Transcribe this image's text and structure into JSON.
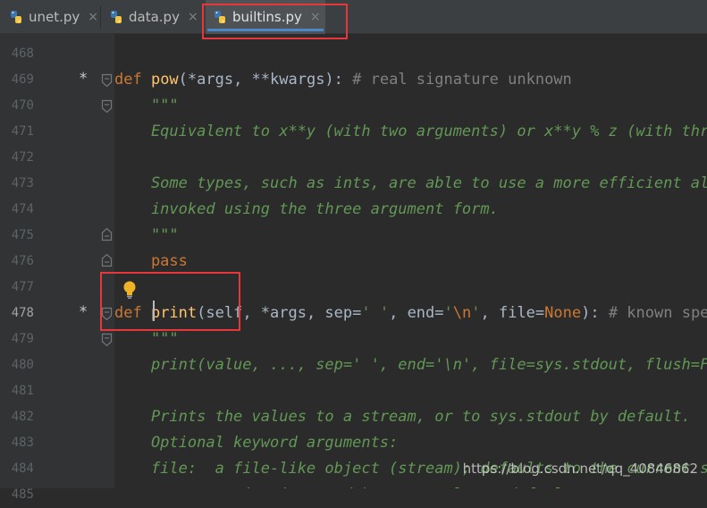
{
  "tabs": [
    {
      "label": "unet.py",
      "close": "×",
      "active": false
    },
    {
      "label": "data.py",
      "close": "×",
      "active": false
    },
    {
      "label": "builtins.py",
      "close": "×",
      "active": true
    }
  ],
  "partial_top_line": "    \"",
  "lines": [
    {
      "num": "468",
      "bookmark": "",
      "code": []
    },
    {
      "num": "469",
      "bookmark": "*",
      "code": [
        [
          "kw",
          "def "
        ],
        [
          "fn",
          "pow"
        ],
        [
          "plain",
          "(*args, **kwargs): "
        ],
        [
          "cmt",
          "# real signature unknown"
        ]
      ]
    },
    {
      "num": "470",
      "bookmark": "",
      "code": [
        [
          "doc",
          "    \"\"\""
        ]
      ]
    },
    {
      "num": "471",
      "bookmark": "",
      "code": [
        [
          "doc",
          "    Equivalent to x**y (with two arguments) or x**y % z (with three arguments)"
        ]
      ]
    },
    {
      "num": "472",
      "bookmark": "",
      "code": []
    },
    {
      "num": "473",
      "bookmark": "",
      "code": [
        [
          "doc",
          "    Some types, such as ints, are able to use a more efficient algorithm when"
        ]
      ]
    },
    {
      "num": "474",
      "bookmark": "",
      "code": [
        [
          "doc",
          "    invoked using the three argument form."
        ]
      ]
    },
    {
      "num": "475",
      "bookmark": "",
      "code": [
        [
          "doc",
          "    \"\"\""
        ]
      ]
    },
    {
      "num": "476",
      "bookmark": "",
      "code": [
        [
          "kw",
          "    pass"
        ]
      ]
    },
    {
      "num": "477",
      "bookmark": "",
      "code": []
    },
    {
      "num": "478",
      "bookmark": "*",
      "current": true,
      "code": [
        [
          "kw",
          "def "
        ],
        [
          "fn",
          "print"
        ],
        [
          "plain",
          "(self, *args, sep="
        ],
        [
          "str",
          "' '"
        ],
        [
          "plain",
          ", end="
        ],
        [
          "str",
          "'"
        ],
        [
          "esc",
          "\\n"
        ],
        [
          "str",
          "'"
        ],
        [
          "plain",
          ", file="
        ],
        [
          "const",
          "None"
        ],
        [
          "plain",
          "): "
        ],
        [
          "cmt",
          "# known special case of print"
        ]
      ]
    },
    {
      "num": "479",
      "bookmark": "",
      "code": [
        [
          "doc",
          "    \"\"\""
        ]
      ]
    },
    {
      "num": "480",
      "bookmark": "",
      "code": [
        [
          "doc",
          "    print(value, ..., sep=' ', end='\\n', file=sys.stdout, flush=False)"
        ]
      ]
    },
    {
      "num": "481",
      "bookmark": "",
      "code": []
    },
    {
      "num": "482",
      "bookmark": "",
      "code": [
        [
          "doc",
          "    Prints the values to a stream, or to sys.stdout by default."
        ]
      ]
    },
    {
      "num": "483",
      "bookmark": "",
      "code": [
        [
          "doc",
          "    Optional keyword arguments:"
        ]
      ]
    },
    {
      "num": "484",
      "bookmark": "",
      "code": [
        [
          "doc",
          "    file:  a file-like object (stream); defaults to the current sys.stdout."
        ]
      ]
    },
    {
      "num": "485",
      "bookmark": "",
      "code": [
        [
          "doc",
          "    sep:   string inserted between values, default a space."
        ]
      ]
    }
  ],
  "watermark": "https://blog.csdn.net/qq_40846862",
  "colors": {
    "keyword": "#cc7832",
    "function": "#ffc66d",
    "docstring": "#629755",
    "comment": "#808080",
    "highlight_box": "#e8373a"
  }
}
